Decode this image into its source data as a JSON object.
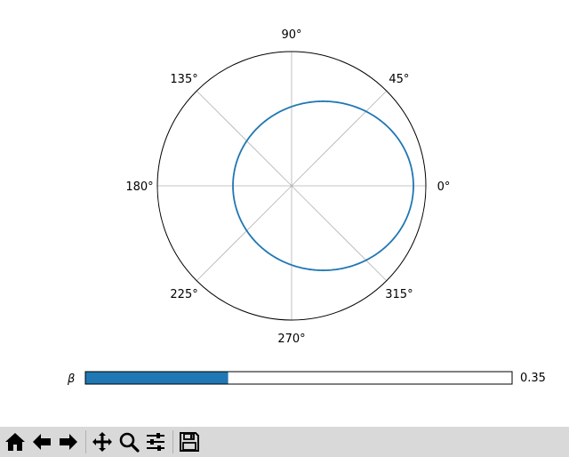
{
  "chart_data": {
    "type": "line",
    "projection": "polar",
    "title": "",
    "angle_ticks": [
      0,
      45,
      90,
      135,
      180,
      225,
      270,
      315
    ],
    "angle_tick_labels": [
      "0°",
      "45°",
      "90°",
      "135°",
      "180°",
      "225°",
      "270°",
      "315°"
    ],
    "radial_grid": false,
    "angular_grid": true,
    "series": [
      {
        "curve": "conic section r = a / (1 - 0.35·cos θ), centre offset to the right of the pole",
        "color": "#1f77b4",
        "eccentricity": 0.35
      }
    ]
  },
  "slider": {
    "label": "β",
    "value": 0.35,
    "value_text": "0.35",
    "min": 0,
    "max": 1,
    "fill_color": "#1f77b4"
  },
  "toolbar": {
    "buttons": [
      {
        "name": "home-button",
        "icon": "home-icon"
      },
      {
        "name": "back-button",
        "icon": "arrow-left-icon"
      },
      {
        "name": "forward-button",
        "icon": "arrow-right-icon"
      },
      {
        "name": "pan-button",
        "icon": "move-icon"
      },
      {
        "name": "zoom-button",
        "icon": "magnifier-icon"
      },
      {
        "name": "configure-subplots-button",
        "icon": "sliders-icon"
      },
      {
        "name": "save-button",
        "icon": "floppy-disk-icon"
      }
    ]
  }
}
